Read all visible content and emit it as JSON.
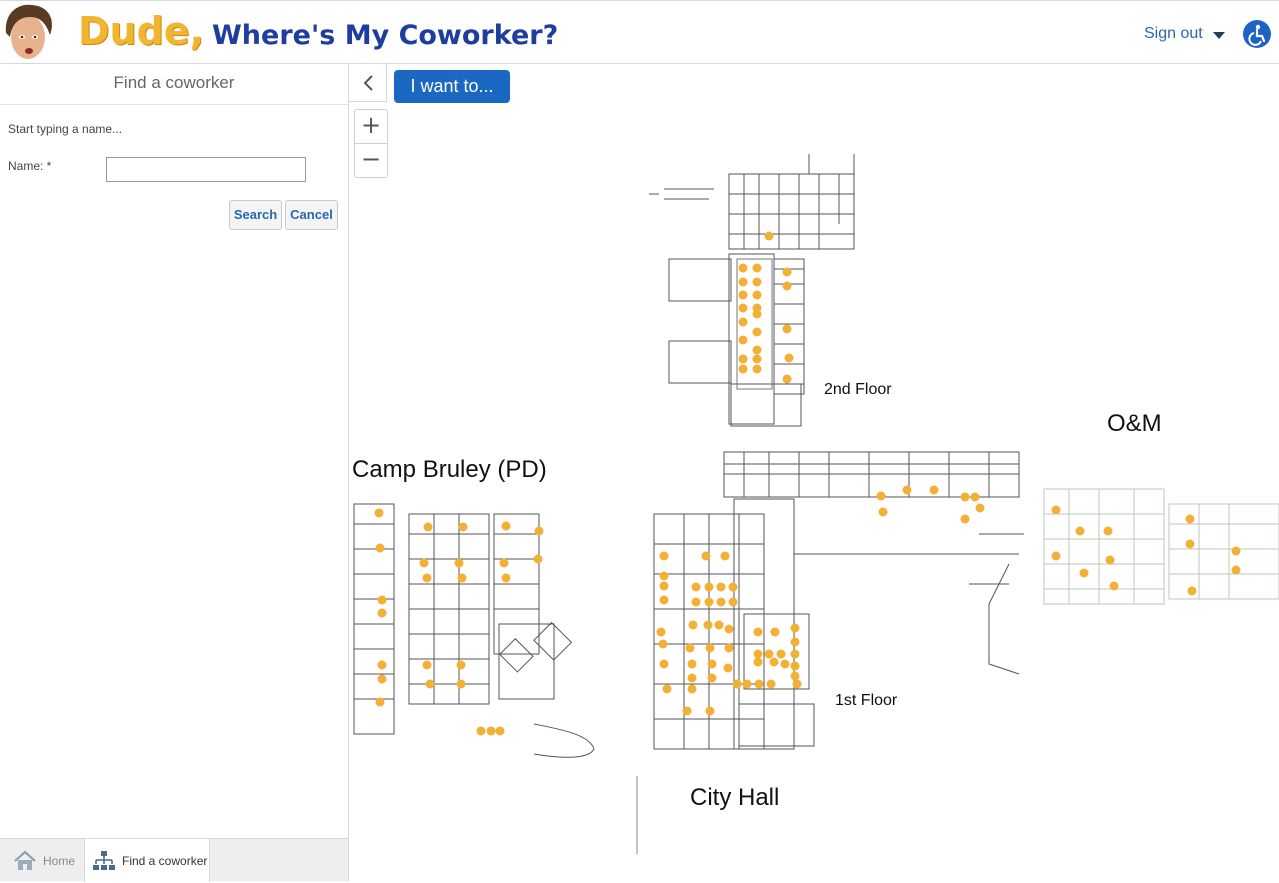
{
  "header": {
    "logo_first": "Dude,",
    "logo_rest": "Where's My Coworker?",
    "signout_label": "Sign out"
  },
  "panel": {
    "title": "Find a coworker",
    "hint": "Start typing a name...",
    "name_label": "Name: *",
    "name_value": "",
    "search_label": "Search",
    "cancel_label": "Cancel"
  },
  "tabs": [
    {
      "label": "Home",
      "icon": "home-icon",
      "active": false
    },
    {
      "label": "Find a coworker",
      "icon": "org-chart-icon",
      "active": true
    }
  ],
  "map": {
    "iwant_label": "I want to...",
    "zoom_in": "+",
    "zoom_out": "−",
    "labels": {
      "floor2": "2nd Floor",
      "om": "O&M",
      "camp": "Camp Bruley (PD)",
      "floor1": "1st Floor",
      "cityhall": "City Hall"
    }
  },
  "colors": {
    "accent": "#1a68c2",
    "desk_marker": "#f2b134",
    "link": "#2a67b0"
  }
}
